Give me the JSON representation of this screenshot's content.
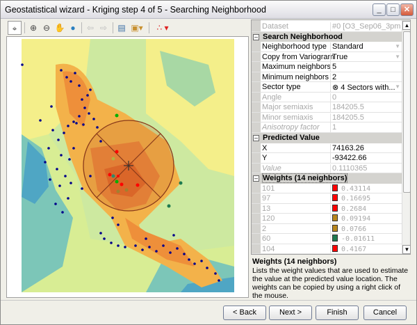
{
  "window": {
    "title": "Geostatistical wizard - Kriging step 4 of 5 - Searching Neighborhood"
  },
  "toolbar": {
    "icons": [
      "crosshair-icon",
      "zoom-in-icon",
      "zoom-out-icon",
      "pan-hand-icon",
      "full-extent-globe-icon",
      "back-arrow-icon",
      "forward-arrow-icon",
      "table-icon",
      "layer-icon",
      "points-symbology-icon"
    ]
  },
  "grid": {
    "dataset": {
      "label": "Dataset",
      "value": "#0 [O3_Sep06_3pm -..."
    },
    "search": {
      "title": "Search Neighborhood",
      "rows": [
        {
          "label": "Neighborhood type",
          "value": "Standard"
        },
        {
          "label": "Copy from Variogram",
          "value": "True"
        },
        {
          "label": "Maximum neighbors",
          "value": "5"
        },
        {
          "label": "Minimum neighbors",
          "value": "2"
        },
        {
          "label": "Sector type",
          "value": "4 Sectors with..."
        },
        {
          "label": "Angle",
          "value": "0"
        },
        {
          "label": "Major semiaxis",
          "value": "184205.5"
        },
        {
          "label": "Minor semiaxis",
          "value": "184205.5"
        },
        {
          "label": "Anisotropy factor",
          "value": "1"
        }
      ]
    },
    "predicted": {
      "title": "Predicted Value",
      "rows": [
        {
          "label": "X",
          "value": "74163.26"
        },
        {
          "label": "Y",
          "value": "-93422.66"
        },
        {
          "label": "Value",
          "value": "0.1110365"
        }
      ]
    },
    "weights": {
      "title": "Weights (14 neighbors)",
      "rows": [
        {
          "label": "101",
          "value": "0.43114",
          "color": "#ff0000"
        },
        {
          "label": "97",
          "value": "0.16695",
          "color": "#ff0000"
        },
        {
          "label": "13",
          "value": "0.2684",
          "color": "#ff0000"
        },
        {
          "label": "120",
          "value": "0.09194",
          "color": "#b8861b"
        },
        {
          "label": "2",
          "value": "0.0766",
          "color": "#b8861b"
        },
        {
          "label": "60",
          "value": "-0.01611",
          "color": "#1f7a4f"
        },
        {
          "label": "104",
          "value": "0.4167",
          "color": "#ff0000"
        }
      ]
    }
  },
  "description": {
    "title": "Weights (14 neighbors)",
    "text": "Lists the weight values that are used to estimate the value at the predicted value location. The weights can be copied by using a right click of the mouse."
  },
  "buttons": {
    "back": "< Back",
    "next": "Next >",
    "finish": "Finish",
    "cancel": "Cancel"
  }
}
